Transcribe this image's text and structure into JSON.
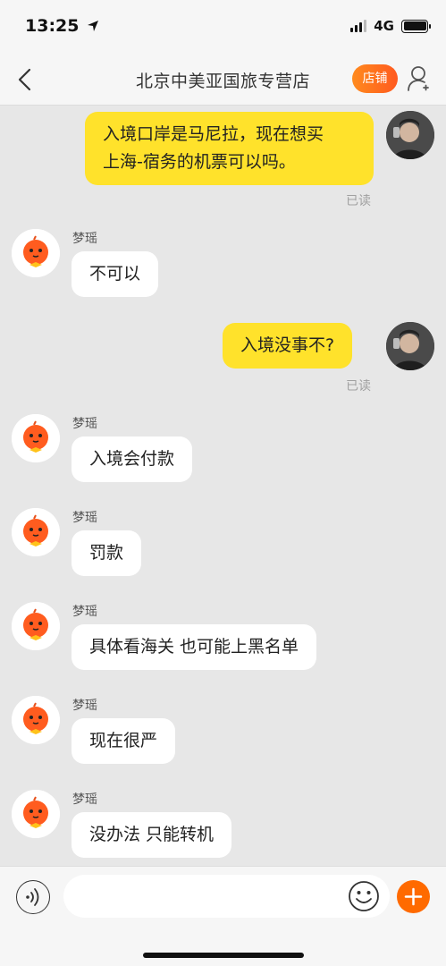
{
  "status": {
    "time": "13:25",
    "network": "4G",
    "icons": [
      "location-arrow-icon",
      "signal-icon",
      "battery-icon"
    ]
  },
  "header": {
    "title": "北京中美亚国旅专营店",
    "shop_button": "店铺",
    "icons": [
      "back-arrow-icon",
      "user-icon"
    ]
  },
  "messages": [
    {
      "from": "me",
      "text_line1": "入境口岸是马尼拉，现在想买",
      "text_line2": "上海-宿务的机票可以吗。",
      "read": "已读"
    },
    {
      "from": "them",
      "name": "梦瑶",
      "text": "不可以"
    },
    {
      "from": "me",
      "text": "入境没事不?",
      "read": "已读"
    },
    {
      "from": "them",
      "name": "梦瑶",
      "text": "入境会付款"
    },
    {
      "from": "them",
      "name": "梦瑶",
      "text": "罚款"
    },
    {
      "from": "them",
      "name": "梦瑶",
      "text": "具体看海关 也可能上黑名单"
    },
    {
      "from": "them",
      "name": "梦瑶",
      "text": "现在很严"
    },
    {
      "from": "them",
      "name": "梦瑶",
      "text": "没办法 只能转机"
    }
  ],
  "input": {
    "placeholder": "",
    "icons": [
      "voice-icon",
      "emoji-icon",
      "plus-icon"
    ]
  },
  "colors": {
    "my_bubble": "#ffe22b",
    "their_bubble": "#ffffff",
    "accent": "#ff6a00",
    "background": "#e7e7e7"
  }
}
